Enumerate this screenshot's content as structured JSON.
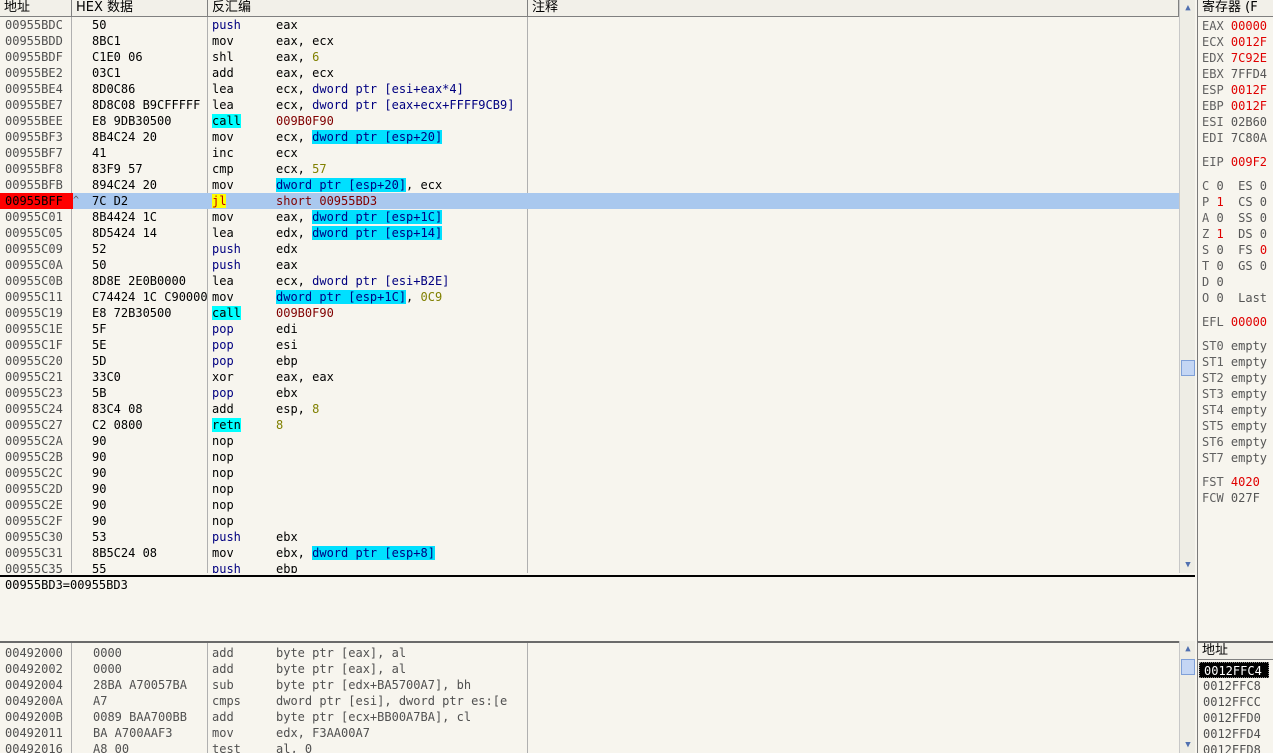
{
  "headers": {
    "addr": "地址",
    "hex": "HEX 数据",
    "disasm": "反汇编",
    "comment": "注释",
    "regs": "寄存器 (F",
    "stack_addr": "地址"
  },
  "rows": [
    {
      "addr": "00955BDC",
      "hex": "50",
      "mn": "push",
      "mnc": "mn-blue",
      "ops": [
        {
          "t": "eax",
          "c": "op-reg"
        }
      ]
    },
    {
      "addr": "00955BDD",
      "hex": "8BC1",
      "mn": "mov",
      "mnc": "",
      "ops": [
        {
          "t": "eax, ecx",
          "c": "op-reg"
        }
      ]
    },
    {
      "addr": "00955BDF",
      "hex": "C1E0 06",
      "mn": "shl",
      "mnc": "",
      "ops": [
        {
          "t": "eax, ",
          "c": "op-reg"
        },
        {
          "t": "6",
          "c": "op-num"
        }
      ]
    },
    {
      "addr": "00955BE2",
      "hex": "03C1",
      "mn": "add",
      "mnc": "",
      "ops": [
        {
          "t": "eax, ecx",
          "c": "op-reg"
        }
      ]
    },
    {
      "addr": "00955BE4",
      "hex": "8D0C86",
      "mn": "lea",
      "mnc": "",
      "ops": [
        {
          "t": "ecx, ",
          "c": "op-reg"
        },
        {
          "t": "dword ptr [esi+eax*4]",
          "c": "op-memplain"
        }
      ]
    },
    {
      "addr": "00955BE7",
      "hex": "8D8C08 B9CFFFFF",
      "mn": "lea",
      "mnc": "",
      "ops": [
        {
          "t": "ecx, ",
          "c": "op-reg"
        },
        {
          "t": "dword ptr [eax+ecx+FFFF9CB9]",
          "c": "op-memplain"
        }
      ]
    },
    {
      "addr": "00955BEE",
      "hex": "E8 9DB30500",
      "mn": "call",
      "mnc": "mn-call",
      "ops": [
        {
          "t": "009B0F90",
          "c": "op-addr"
        }
      ]
    },
    {
      "addr": "00955BF3",
      "hex": "8B4C24 20",
      "mn": "mov",
      "mnc": "",
      "ops": [
        {
          "t": "ecx, ",
          "c": "op-reg"
        },
        {
          "t": "dword ptr [esp+20]",
          "c": "op-mem"
        }
      ]
    },
    {
      "addr": "00955BF7",
      "hex": "41",
      "mn": "inc",
      "mnc": "",
      "ops": [
        {
          "t": "ecx",
          "c": "op-reg"
        }
      ]
    },
    {
      "addr": "00955BF8",
      "hex": "83F9 57",
      "mn": "cmp",
      "mnc": "",
      "ops": [
        {
          "t": "ecx, ",
          "c": "op-reg"
        },
        {
          "t": "57",
          "c": "op-num"
        }
      ]
    },
    {
      "addr": "00955BFB",
      "hex": "894C24 20",
      "mn": "mov",
      "mnc": "",
      "ops": [
        {
          "t": "dword ptr [esp+20]",
          "c": "op-mem"
        },
        {
          "t": ", ecx",
          "c": "op-reg"
        }
      ]
    },
    {
      "addr": "00955BFF",
      "hex": "7C D2",
      "mn": "jl",
      "mnc": "mn-jl",
      "mark": "^",
      "sel": true,
      "ops": [
        {
          "t": "short 00955BD3",
          "c": "op-addr"
        }
      ]
    },
    {
      "addr": "00955C01",
      "hex": "8B4424 1C",
      "mn": "mov",
      "mnc": "",
      "ops": [
        {
          "t": "eax, ",
          "c": "op-reg"
        },
        {
          "t": "dword ptr [esp+1C]",
          "c": "op-mem"
        }
      ]
    },
    {
      "addr": "00955C05",
      "hex": "8D5424 14",
      "mn": "lea",
      "mnc": "",
      "ops": [
        {
          "t": "edx, ",
          "c": "op-reg"
        },
        {
          "t": "dword ptr [esp+14]",
          "c": "op-mem"
        }
      ]
    },
    {
      "addr": "00955C09",
      "hex": "52",
      "mn": "push",
      "mnc": "mn-blue",
      "ops": [
        {
          "t": "edx",
          "c": "op-reg"
        }
      ]
    },
    {
      "addr": "00955C0A",
      "hex": "50",
      "mn": "push",
      "mnc": "mn-blue",
      "ops": [
        {
          "t": "eax",
          "c": "op-reg"
        }
      ]
    },
    {
      "addr": "00955C0B",
      "hex": "8D8E 2E0B0000",
      "mn": "lea",
      "mnc": "",
      "ops": [
        {
          "t": "ecx, ",
          "c": "op-reg"
        },
        {
          "t": "dword ptr [esi+B2E]",
          "c": "op-memplain"
        }
      ]
    },
    {
      "addr": "00955C11",
      "hex": "C74424 1C C9000000",
      "mn": "mov",
      "mnc": "",
      "ops": [
        {
          "t": "dword ptr [esp+1C]",
          "c": "op-mem"
        },
        {
          "t": ", ",
          "c": "op-reg"
        },
        {
          "t": "0C9",
          "c": "op-num"
        }
      ]
    },
    {
      "addr": "00955C19",
      "hex": "E8 72B30500",
      "mn": "call",
      "mnc": "mn-call",
      "ops": [
        {
          "t": "009B0F90",
          "c": "op-addr"
        }
      ]
    },
    {
      "addr": "00955C1E",
      "hex": "5F",
      "mn": "pop",
      "mnc": "mn-blue",
      "ops": [
        {
          "t": "edi",
          "c": "op-reg"
        }
      ]
    },
    {
      "addr": "00955C1F",
      "hex": "5E",
      "mn": "pop",
      "mnc": "mn-blue",
      "ops": [
        {
          "t": "esi",
          "c": "op-reg"
        }
      ]
    },
    {
      "addr": "00955C20",
      "hex": "5D",
      "mn": "pop",
      "mnc": "mn-blue",
      "ops": [
        {
          "t": "ebp",
          "c": "op-reg"
        }
      ]
    },
    {
      "addr": "00955C21",
      "hex": "33C0",
      "mn": "xor",
      "mnc": "",
      "ops": [
        {
          "t": "eax, eax",
          "c": "op-reg"
        }
      ]
    },
    {
      "addr": "00955C23",
      "hex": "5B",
      "mn": "pop",
      "mnc": "mn-blue",
      "ops": [
        {
          "t": "ebx",
          "c": "op-reg"
        }
      ]
    },
    {
      "addr": "00955C24",
      "hex": "83C4 08",
      "mn": "add",
      "mnc": "",
      "ops": [
        {
          "t": "esp, ",
          "c": "op-reg"
        },
        {
          "t": "8",
          "c": "op-num"
        }
      ]
    },
    {
      "addr": "00955C27",
      "hex": "C2 0800",
      "mn": "retn",
      "mnc": "mn-retn",
      "ops": [
        {
          "t": "8",
          "c": "op-num"
        }
      ]
    },
    {
      "addr": "00955C2A",
      "hex": "90",
      "mn": "nop",
      "mnc": "",
      "ops": []
    },
    {
      "addr": "00955C2B",
      "hex": "90",
      "mn": "nop",
      "mnc": "",
      "ops": []
    },
    {
      "addr": "00955C2C",
      "hex": "90",
      "mn": "nop",
      "mnc": "",
      "ops": []
    },
    {
      "addr": "00955C2D",
      "hex": "90",
      "mn": "nop",
      "mnc": "",
      "ops": []
    },
    {
      "addr": "00955C2E",
      "hex": "90",
      "mn": "nop",
      "mnc": "",
      "ops": []
    },
    {
      "addr": "00955C2F",
      "hex": "90",
      "mn": "nop",
      "mnc": "",
      "ops": []
    },
    {
      "addr": "00955C30",
      "hex": "53",
      "mn": "push",
      "mnc": "mn-blue",
      "ops": [
        {
          "t": "ebx",
          "c": "op-reg"
        }
      ]
    },
    {
      "addr": "00955C31",
      "hex": "8B5C24 08",
      "mn": "mov",
      "mnc": "",
      "ops": [
        {
          "t": "ebx, ",
          "c": "op-reg"
        },
        {
          "t": "dword ptr [esp+8]",
          "c": "op-mem"
        }
      ]
    },
    {
      "addr": "00955C35",
      "hex": "55",
      "mn": "push",
      "mnc": "mn-blue",
      "ops": [
        {
          "t": "ebp",
          "c": "op-reg"
        }
      ]
    }
  ],
  "info_text": "00955BD3=00955BD3",
  "dump_rows": [
    {
      "addr": "00492000",
      "hex": "0000",
      "mn": "add",
      "ops": "byte ptr [eax], al"
    },
    {
      "addr": "00492002",
      "hex": "0000",
      "mn": "add",
      "ops": "byte ptr [eax], al"
    },
    {
      "addr": "00492004",
      "hex": "28BA A70057BA",
      "mn": "sub",
      "ops": "byte ptr [edx+BA5700A7], bh"
    },
    {
      "addr": "0049200A",
      "hex": "A7",
      "mn": "cmps",
      "ops": "dword ptr [esi], dword ptr es:[e"
    },
    {
      "addr": "0049200B",
      "hex": "0089 BAA700BB",
      "mn": "add",
      "ops": "byte ptr [ecx+BB00A7BA], cl"
    },
    {
      "addr": "00492011",
      "hex": "BA A700AAF3",
      "mn": "mov",
      "ops": "edx, F3AA00A7"
    },
    {
      "addr": "00492016",
      "hex": "A8 00",
      "mn": "test",
      "ops": "al, 0"
    }
  ],
  "registers": [
    {
      "name": "EAX",
      "val": "00000",
      "vc": "rval-red"
    },
    {
      "name": "ECX",
      "val": "0012F",
      "vc": "rval-red"
    },
    {
      "name": "EDX",
      "val": "7C92E",
      "vc": "rval-red"
    },
    {
      "name": "EBX",
      "val": "7FFD4",
      "vc": "rval-gray"
    },
    {
      "name": "ESP",
      "val": "0012F",
      "vc": "rval-red"
    },
    {
      "name": "EBP",
      "val": "0012F",
      "vc": "rval-red"
    },
    {
      "name": "ESI",
      "val": "02B60",
      "vc": "rval-gray"
    },
    {
      "name": "EDI",
      "val": "7C80A",
      "vc": "rval-gray"
    },
    {
      "gap": true
    },
    {
      "name": "EIP",
      "val": "009F2",
      "vc": "rval-red"
    },
    {
      "gap": true
    },
    {
      "name": "C",
      "val": "0  ES 0",
      "vc": "rval-gray"
    },
    {
      "name": "P",
      "val": "1",
      "vc": "rval-red",
      "tail": "  CS 0"
    },
    {
      "name": "A",
      "val": "0  SS 0",
      "vc": "rval-gray"
    },
    {
      "name": "Z",
      "val": "1",
      "vc": "rval-red",
      "tail": "  DS 0"
    },
    {
      "name": "S",
      "val": "0  FS ",
      "vc": "rval-gray",
      "tail2": "0"
    },
    {
      "name": "T",
      "val": "0  GS 0",
      "vc": "rval-gray"
    },
    {
      "name": "D",
      "val": "0",
      "vc": "rval-gray"
    },
    {
      "name": "O",
      "val": "0  Last",
      "vc": "rval-gray"
    },
    {
      "gap": true
    },
    {
      "name": "EFL",
      "val": "00000",
      "vc": "rval-red"
    },
    {
      "gap": true
    },
    {
      "name": "ST0",
      "val": "empty",
      "vc": "rval-gray"
    },
    {
      "name": "ST1",
      "val": "empty",
      "vc": "rval-gray"
    },
    {
      "name": "ST2",
      "val": "empty",
      "vc": "rval-gray"
    },
    {
      "name": "ST3",
      "val": "empty",
      "vc": "rval-gray"
    },
    {
      "name": "ST4",
      "val": "empty",
      "vc": "rval-gray"
    },
    {
      "name": "ST5",
      "val": "empty",
      "vc": "rval-gray"
    },
    {
      "name": "ST6",
      "val": "empty",
      "vc": "rval-gray"
    },
    {
      "name": "ST7",
      "val": "empty",
      "vc": "rval-gray"
    },
    {
      "gap": true
    },
    {
      "name": "FST",
      "val": "4020",
      "vc": "rval-red"
    },
    {
      "name": "FCW",
      "val": "027F",
      "vc": "rval-gray"
    }
  ],
  "stack_rows": [
    {
      "addr": "0012FFC4",
      "sel": true
    },
    {
      "addr": "0012FFC8"
    },
    {
      "addr": "0012FFCC"
    },
    {
      "addr": "0012FFD0"
    },
    {
      "addr": "0012FFD4"
    },
    {
      "addr": "0012FFD8"
    }
  ],
  "scroll": {
    "up": "▲",
    "down": "▼"
  }
}
